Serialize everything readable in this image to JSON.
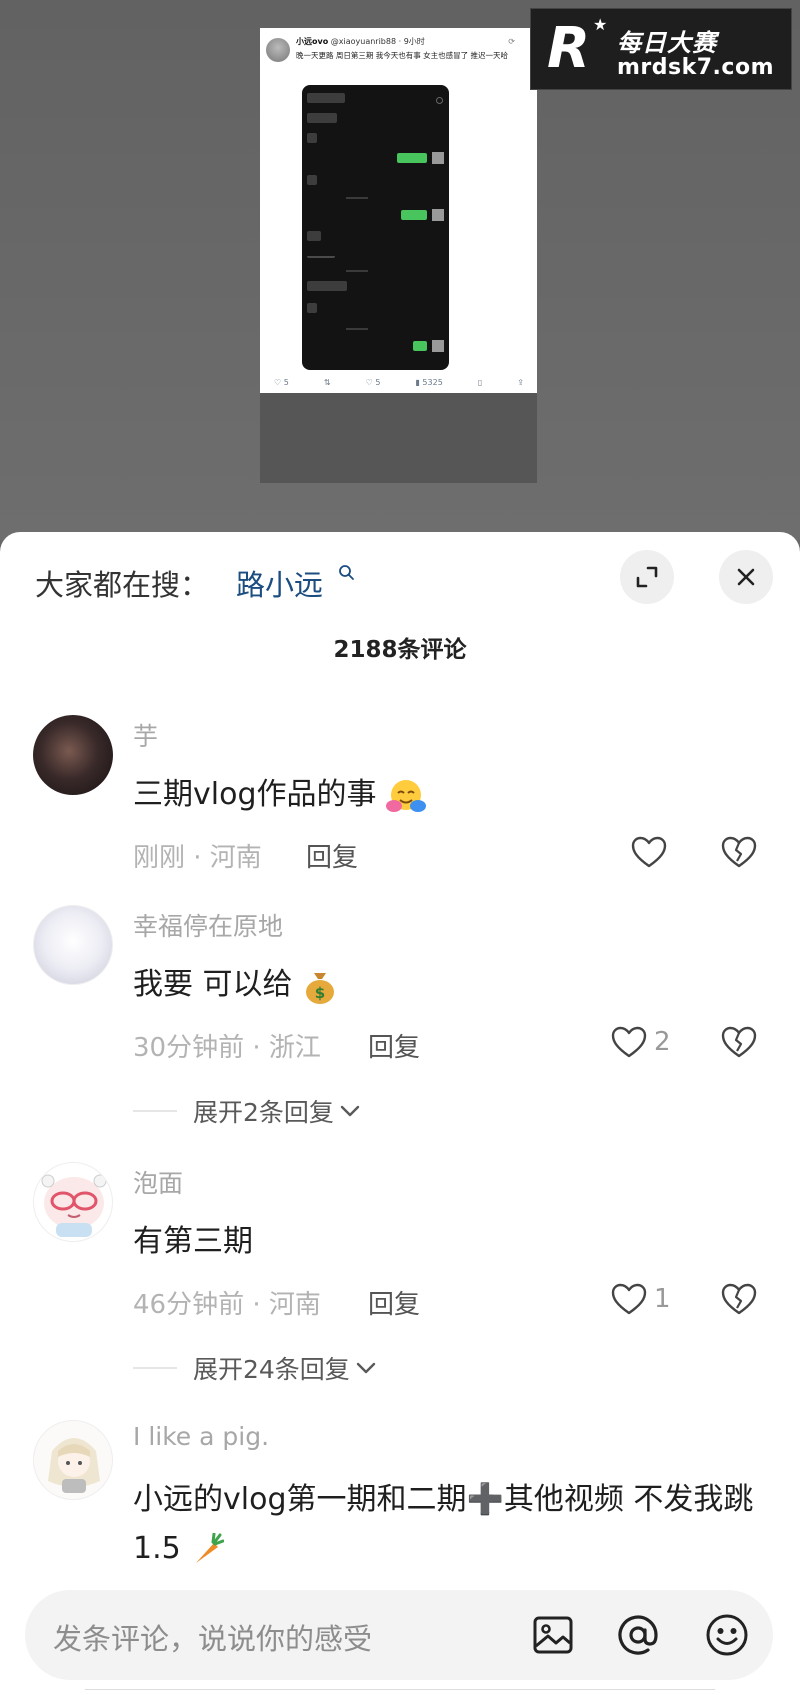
{
  "post": {
    "user": "小远ovo",
    "handle": "@xiaoyuanrib88 · 9小时",
    "text": "晚一天更路 周日第三期 我今天也有事 女主也感冒了 推迟一天哈",
    "stats": [
      "5",
      "",
      "5",
      "5325"
    ]
  },
  "watermark": {
    "mark": "R",
    "cn": "每日大赛",
    "url": "mrdsk7.com"
  },
  "sheet": {
    "search_prefix": "大家都在搜：",
    "search_term": "路小远",
    "comment_count": "2188条评论",
    "input_placeholder": "发条评论，说说你的感受"
  },
  "comments": [
    {
      "name": "芋",
      "text": "三期vlog作品的事",
      "time": "刚刚 · 河南",
      "reply": "回复",
      "likes": "",
      "avatar_color": "#3a2a2a"
    },
    {
      "name": "幸福停在原地",
      "text": "我要 可以给",
      "time": "30分钟前 · 浙江",
      "reply": "回复",
      "likes": "2",
      "expand": "展开2条回复",
      "avatar_color": "#e8e8ef"
    },
    {
      "name": "泡面",
      "text": "有第三期",
      "time": "46分钟前 · 河南",
      "reply": "回复",
      "likes": "1",
      "expand": "展开24条回复",
      "avatar_color": "#fbe4e4"
    },
    {
      "name": "I like a pig.",
      "text": "小远的vlog第一期和二期➕其他视频 不发我跳1.5",
      "avatar_color": "#f0ece6"
    }
  ],
  "colors": {
    "search_term": "#1b4d80",
    "meta": "#b3b3b3",
    "name": "#a7a7a7"
  }
}
